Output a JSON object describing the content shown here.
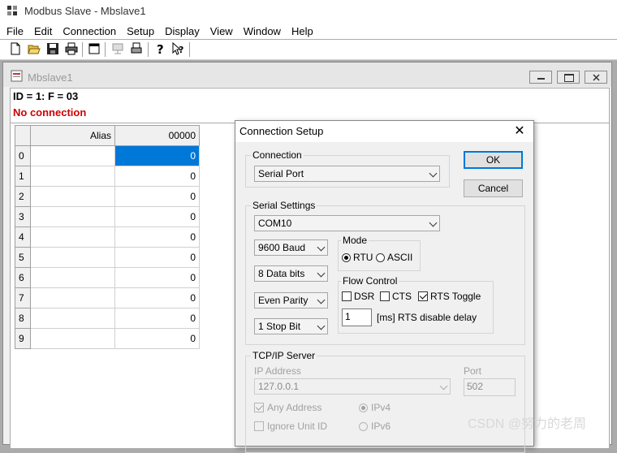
{
  "app": {
    "title": "Modbus Slave - Mbslave1"
  },
  "menu": [
    "File",
    "Edit",
    "Connection",
    "Setup",
    "Display",
    "View",
    "Window",
    "Help"
  ],
  "toolbar": {
    "icons": [
      "new-icon",
      "open-icon",
      "save-icon",
      "print-icon",
      "window-icon",
      "connect-icon",
      "print-preview-icon",
      "help-icon",
      "context-help-icon"
    ]
  },
  "child": {
    "title": "Mbslave1",
    "id_line": "ID = 1: F = 03",
    "status": "No connection",
    "status_color": "#d00000",
    "columns": [
      "Alias",
      "00000"
    ],
    "rows": [
      {
        "idx": "0",
        "alias": "",
        "value": "0"
      },
      {
        "idx": "1",
        "alias": "",
        "value": "0"
      },
      {
        "idx": "2",
        "alias": "",
        "value": "0"
      },
      {
        "idx": "3",
        "alias": "",
        "value": "0"
      },
      {
        "idx": "4",
        "alias": "",
        "value": "0"
      },
      {
        "idx": "5",
        "alias": "",
        "value": "0"
      },
      {
        "idx": "6",
        "alias": "",
        "value": "0"
      },
      {
        "idx": "7",
        "alias": "",
        "value": "0"
      },
      {
        "idx": "8",
        "alias": "",
        "value": "0"
      },
      {
        "idx": "9",
        "alias": "",
        "value": "0"
      }
    ]
  },
  "dialog": {
    "title": "Connection Setup",
    "connection_label": "Connection",
    "connection_value": "Serial Port",
    "ok": "OK",
    "cancel": "Cancel",
    "serial_label": "Serial Settings",
    "port": "COM10",
    "baud": "9600 Baud",
    "data_bits": "8 Data bits",
    "parity": "Even Parity",
    "stop_bits": "1 Stop Bit",
    "mode_label": "Mode",
    "mode_rtu": "RTU",
    "mode_ascii": "ASCII",
    "flow_label": "Flow Control",
    "dsr": "DSR",
    "cts": "CTS",
    "rts_toggle": "RTS Toggle",
    "rts_delay_value": "1",
    "rts_delay_label": "[ms] RTS disable delay",
    "tcp_label": "TCP/IP Server",
    "ip_label": "IP Address",
    "ip_value": "127.0.0.1",
    "port_label": "Port",
    "port_value": "502",
    "any_address": "Any Address",
    "ipv4": "IPv4",
    "ignore_unit": "Ignore Unit ID",
    "ipv6": "IPv6"
  },
  "watermark": "CSDN @努力的老周",
  "accent": "#0078d7"
}
